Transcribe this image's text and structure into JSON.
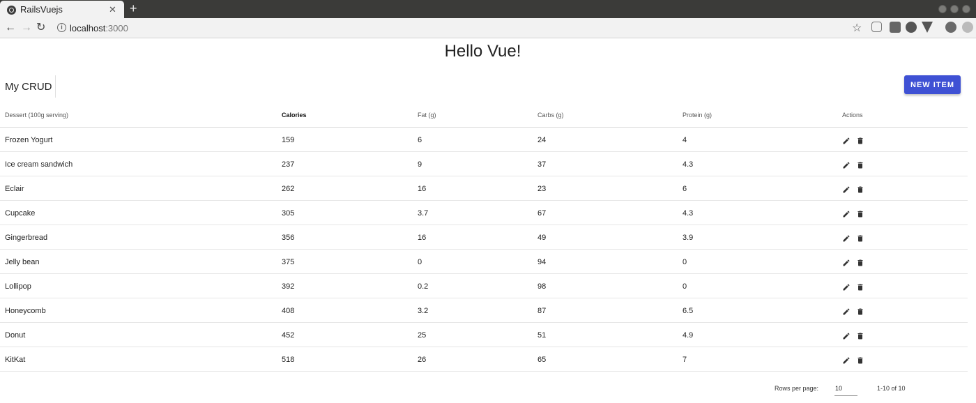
{
  "browser": {
    "tab_title": "RailsVuejs",
    "url_host": "localhost",
    "url_port": ":3000"
  },
  "page": {
    "title": "Hello Vue!",
    "crud_title": "My CRUD",
    "new_item_label": "NEW ITEM",
    "accent_color": "#3f51d4"
  },
  "table": {
    "headers": [
      "Dessert (100g serving)",
      "Calories",
      "Fat (g)",
      "Carbs (g)",
      "Protein (g)",
      "Actions"
    ],
    "sorted_column": "Calories",
    "rows": [
      [
        "Frozen Yogurt",
        "159",
        "6",
        "24",
        "4"
      ],
      [
        "Ice cream sandwich",
        "237",
        "9",
        "37",
        "4.3"
      ],
      [
        "Eclair",
        "262",
        "16",
        "23",
        "6"
      ],
      [
        "Cupcake",
        "305",
        "3.7",
        "67",
        "4.3"
      ],
      [
        "Gingerbread",
        "356",
        "16",
        "49",
        "3.9"
      ],
      [
        "Jelly bean",
        "375",
        "0",
        "94",
        "0"
      ],
      [
        "Lollipop",
        "392",
        "0.2",
        "98",
        "0"
      ],
      [
        "Honeycomb",
        "408",
        "3.2",
        "87",
        "6.5"
      ],
      [
        "Donut",
        "452",
        "25",
        "51",
        "4.9"
      ],
      [
        "KitKat",
        "518",
        "26",
        "65",
        "7"
      ]
    ],
    "row_actions": [
      "pencil-icon",
      "delete-icon"
    ]
  },
  "footer": {
    "rows_per_page_label": "Rows per page:",
    "rows_per_page_value": "10",
    "range_text": "1-10 of 10"
  }
}
